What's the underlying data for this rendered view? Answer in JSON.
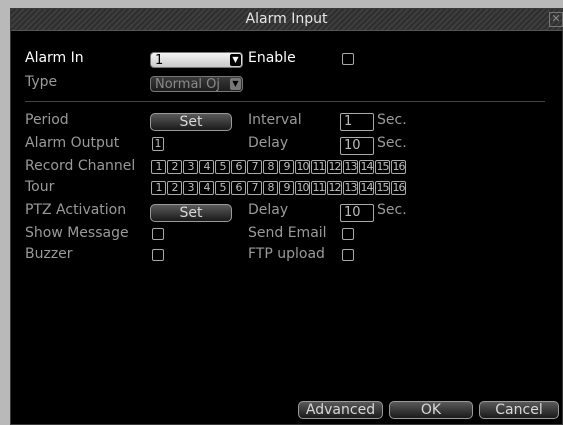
{
  "window": {
    "title": "Alarm Input",
    "close_glyph": "✕"
  },
  "alarm_in": {
    "label": "Alarm In",
    "value": "1"
  },
  "enable": {
    "label": "Enable",
    "checked": false
  },
  "type": {
    "label": "Type",
    "value": "Normal Oj"
  },
  "period": {
    "label": "Period",
    "button": "Set"
  },
  "interval": {
    "label": "Interval",
    "value": "1",
    "unit": "Sec."
  },
  "alarm_output": {
    "label": "Alarm Output",
    "value": "1"
  },
  "delay1": {
    "label": "Delay",
    "value": "10",
    "unit": "Sec."
  },
  "record_channel": {
    "label": "Record Channel",
    "channels": [
      "1",
      "2",
      "3",
      "4",
      "5",
      "6",
      "7",
      "8",
      "9",
      "10",
      "11",
      "12",
      "13",
      "14",
      "15",
      "16"
    ]
  },
  "tour": {
    "label": "Tour",
    "channels": [
      "1",
      "2",
      "3",
      "4",
      "5",
      "6",
      "7",
      "8",
      "9",
      "10",
      "11",
      "12",
      "13",
      "14",
      "15",
      "16"
    ]
  },
  "ptz_activation": {
    "label": "PTZ Activation",
    "button": "Set"
  },
  "delay2": {
    "label": "Delay",
    "value": "10",
    "unit": "Sec."
  },
  "show_message": {
    "label": "Show Message",
    "checked": false
  },
  "send_email": {
    "label": "Send Email",
    "checked": false
  },
  "buzzer": {
    "label": "Buzzer",
    "checked": false
  },
  "ftp_upload": {
    "label": "FTP upload",
    "checked": false
  },
  "footer": {
    "advanced": "Advanced",
    "ok": "OK",
    "cancel": "Cancel"
  }
}
